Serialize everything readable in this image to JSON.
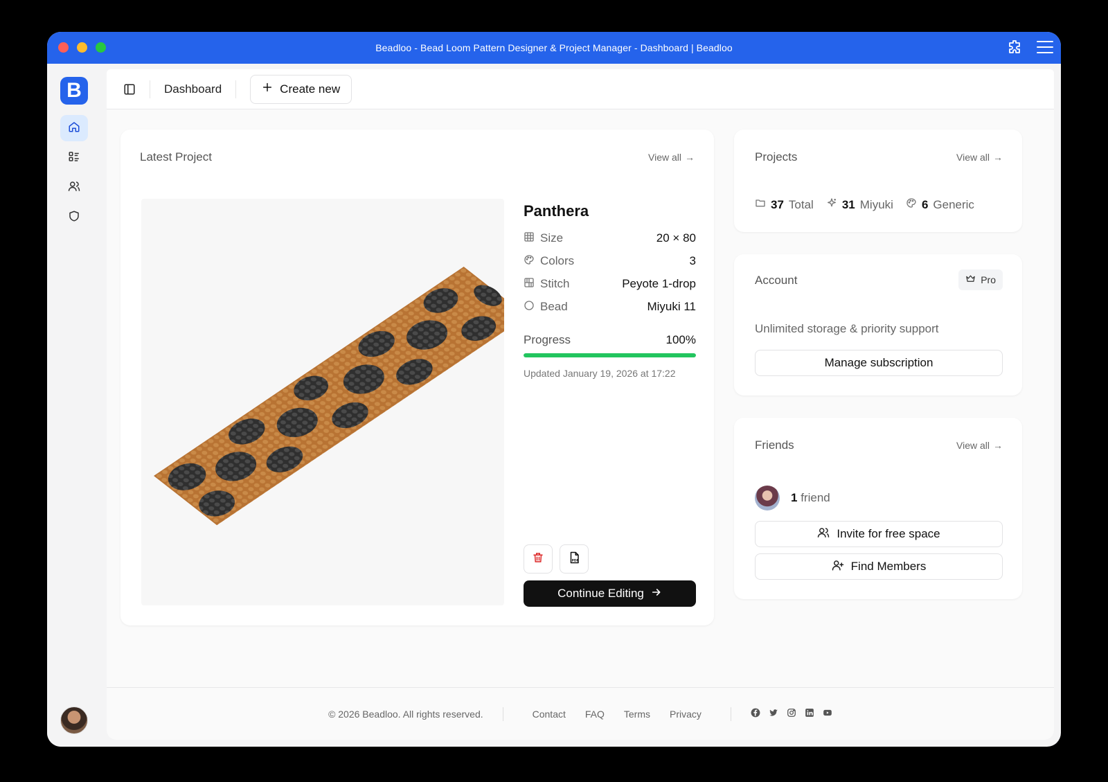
{
  "window": {
    "title": "Beadloo - Bead Loom Pattern Designer & Project Manager - Dashboard | Beadloo"
  },
  "sidebar": {
    "logo_letter": "B",
    "items": [
      {
        "icon": "home-icon"
      },
      {
        "icon": "list-icon"
      },
      {
        "icon": "users-icon"
      },
      {
        "icon": "shield-icon"
      }
    ]
  },
  "topbar": {
    "breadcrumb": "Dashboard",
    "create_label": "Create new"
  },
  "latest": {
    "title": "Latest Project",
    "view_all": "View all",
    "project": {
      "name": "Panthera",
      "specs": [
        {
          "label": "Size",
          "value": "20 × 80",
          "icon": "grid-icon"
        },
        {
          "label": "Colors",
          "value": "3",
          "icon": "palette-icon"
        },
        {
          "label": "Stitch",
          "value": "Peyote 1-drop",
          "icon": "stitch-grid-icon"
        },
        {
          "label": "Bead",
          "value": "Miyuki 11",
          "icon": "circle-icon"
        }
      ],
      "progress_label": "Progress",
      "progress_value": "100%",
      "progress_fraction": 1.0,
      "updated": "Updated January 19, 2026 at 17:22",
      "continue_label": "Continue Editing"
    }
  },
  "projects": {
    "title": "Projects",
    "view_all": "View all",
    "stats": [
      {
        "num": "37",
        "label": "Total",
        "icon": "folder-icon"
      },
      {
        "num": "31",
        "label": "Miyuki",
        "icon": "sparkle-icon"
      },
      {
        "num": "6",
        "label": "Generic",
        "icon": "palette-icon"
      }
    ]
  },
  "account": {
    "title": "Account",
    "plan": "Pro",
    "description": "Unlimited storage & priority support",
    "manage_label": "Manage subscription"
  },
  "friends": {
    "title": "Friends",
    "view_all": "View all",
    "count": "1",
    "count_label": "friend",
    "invite_label": "Invite for free space",
    "find_label": "Find Members"
  },
  "footer": {
    "copyright": "© 2026 Beadloo. All rights reserved.",
    "links": [
      "Contact",
      "FAQ",
      "Terms",
      "Privacy"
    ],
    "socials": [
      "facebook-icon",
      "twitter-icon",
      "instagram-icon",
      "linkedin-icon",
      "youtube-icon"
    ]
  },
  "colors": {
    "accent": "#2563eb",
    "progress": "#22c55e",
    "bead_orange": "#b87333",
    "bead_dark": "#3a3a3a"
  }
}
